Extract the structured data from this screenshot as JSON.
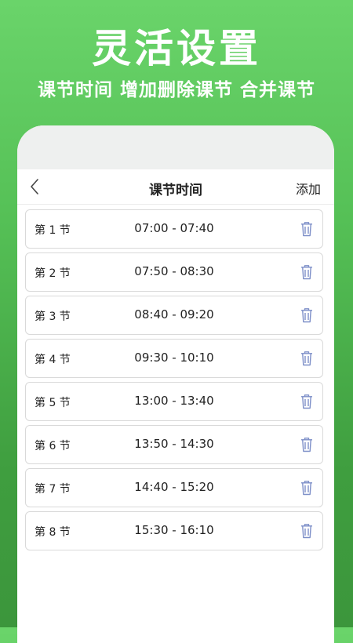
{
  "promo": {
    "title": "灵活设置",
    "subtitle": "课节时间  增加删除课节  合并课节"
  },
  "nav": {
    "title": "课节时间",
    "add_label": "添加"
  },
  "icons": {
    "back": "chevron-left-icon",
    "delete": "trash-icon"
  },
  "colors": {
    "brand_green": "#55c056",
    "trash_icon": "#7d8fc8"
  },
  "periods": [
    {
      "label": "第 1 节",
      "time": "07:00 - 07:40"
    },
    {
      "label": "第 2 节",
      "time": "07:50 - 08:30"
    },
    {
      "label": "第 3 节",
      "time": "08:40 - 09:20"
    },
    {
      "label": "第 4 节",
      "time": "09:30 - 10:10"
    },
    {
      "label": "第 5 节",
      "time": "13:00 - 13:40"
    },
    {
      "label": "第 6 节",
      "time": "13:50 - 14:30"
    },
    {
      "label": "第 7 节",
      "time": "14:40 - 15:20"
    },
    {
      "label": "第 8 节",
      "time": "15:30 - 16:10"
    }
  ]
}
